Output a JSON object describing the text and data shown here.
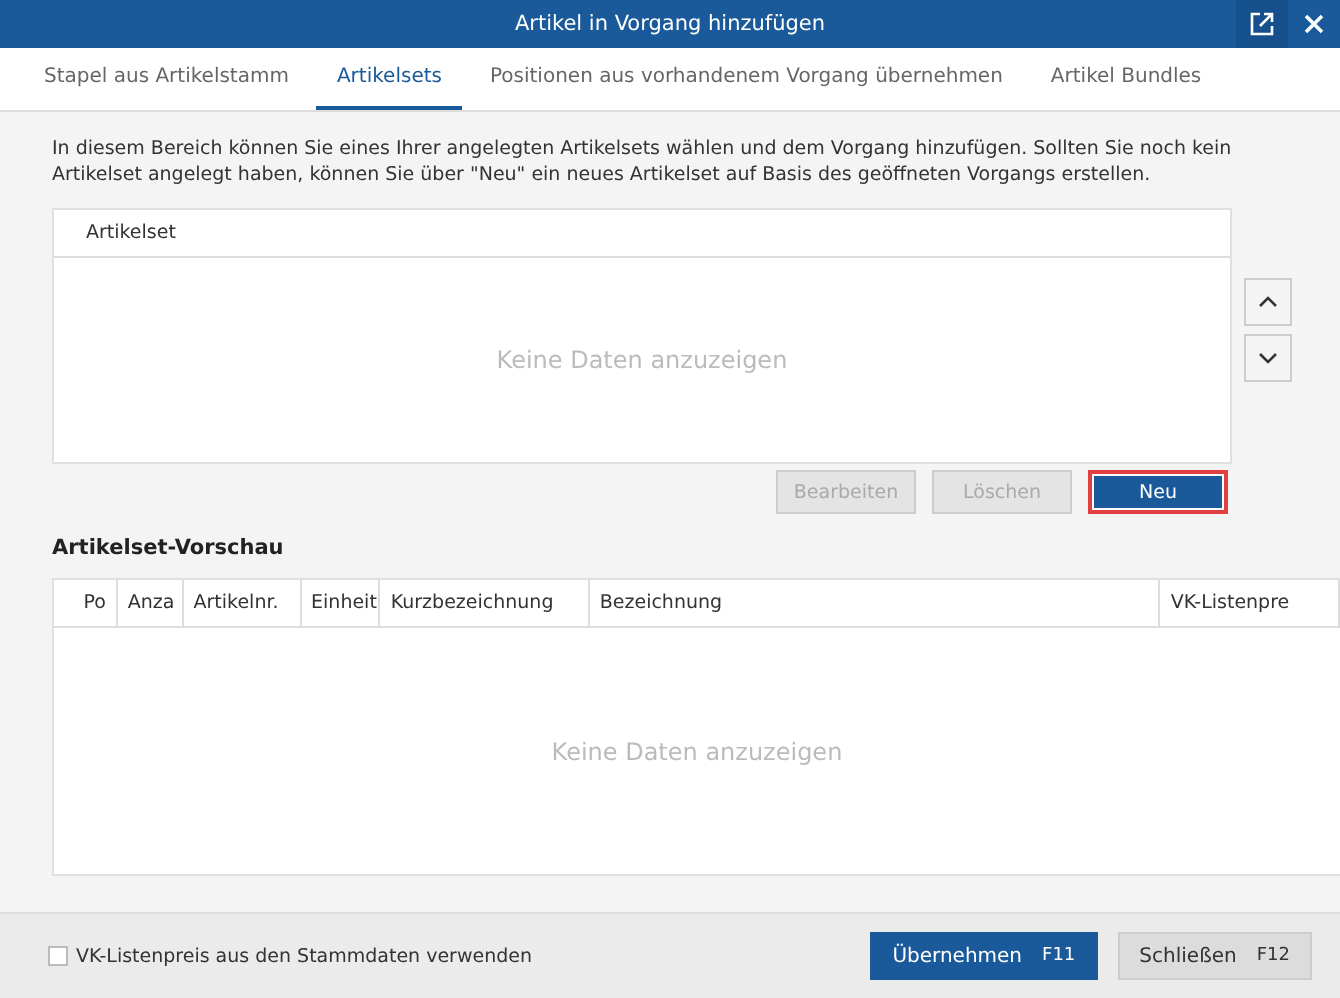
{
  "window": {
    "title": "Artikel in Vorgang hinzufügen"
  },
  "tabs": [
    {
      "label": "Stapel aus Artikelstamm",
      "selected": false
    },
    {
      "label": "Artikelsets",
      "selected": true
    },
    {
      "label": "Positionen aus vorhandenem Vorgang übernehmen",
      "selected": false
    },
    {
      "label": "Artikel Bundles",
      "selected": false
    }
  ],
  "description": "In diesem Bereich können Sie eines Ihrer angelegten Artikelsets wählen und dem Vorgang hinzufügen. Sollten Sie noch kein Artikelset angelegt haben, können Sie über \"Neu\" ein neues Artikelset auf Basis des geöffneten Vorgangs erstellen.",
  "sets_table": {
    "columns": [
      "Artikelset"
    ],
    "empty_text": "Keine Daten anzuzeigen"
  },
  "set_buttons": [
    {
      "label": "Bearbeiten",
      "disabled": true,
      "focused": false
    },
    {
      "label": "Löschen",
      "disabled": true,
      "focused": false
    },
    {
      "label": "Neu",
      "disabled": false,
      "focused": true
    }
  ],
  "preview": {
    "title": "Artikelset-Vorschau",
    "columns": [
      "Po",
      "Anza",
      "Artikelnr.",
      "Einheit",
      "Kurzbezeichnung",
      "Bezeichnung",
      "VK-Listenpre"
    ],
    "empty_text": "Keine Daten anzuzeigen"
  },
  "footer": {
    "checkbox": {
      "label": "VK-Listenpreis aus den Stammdaten verwenden",
      "checked": false
    },
    "buttons": [
      {
        "label": "Übernehmen",
        "shortcut": "F11",
        "kind": "primary"
      },
      {
        "label": "Schließen",
        "shortcut": "F12",
        "kind": "secondary"
      }
    ]
  }
}
